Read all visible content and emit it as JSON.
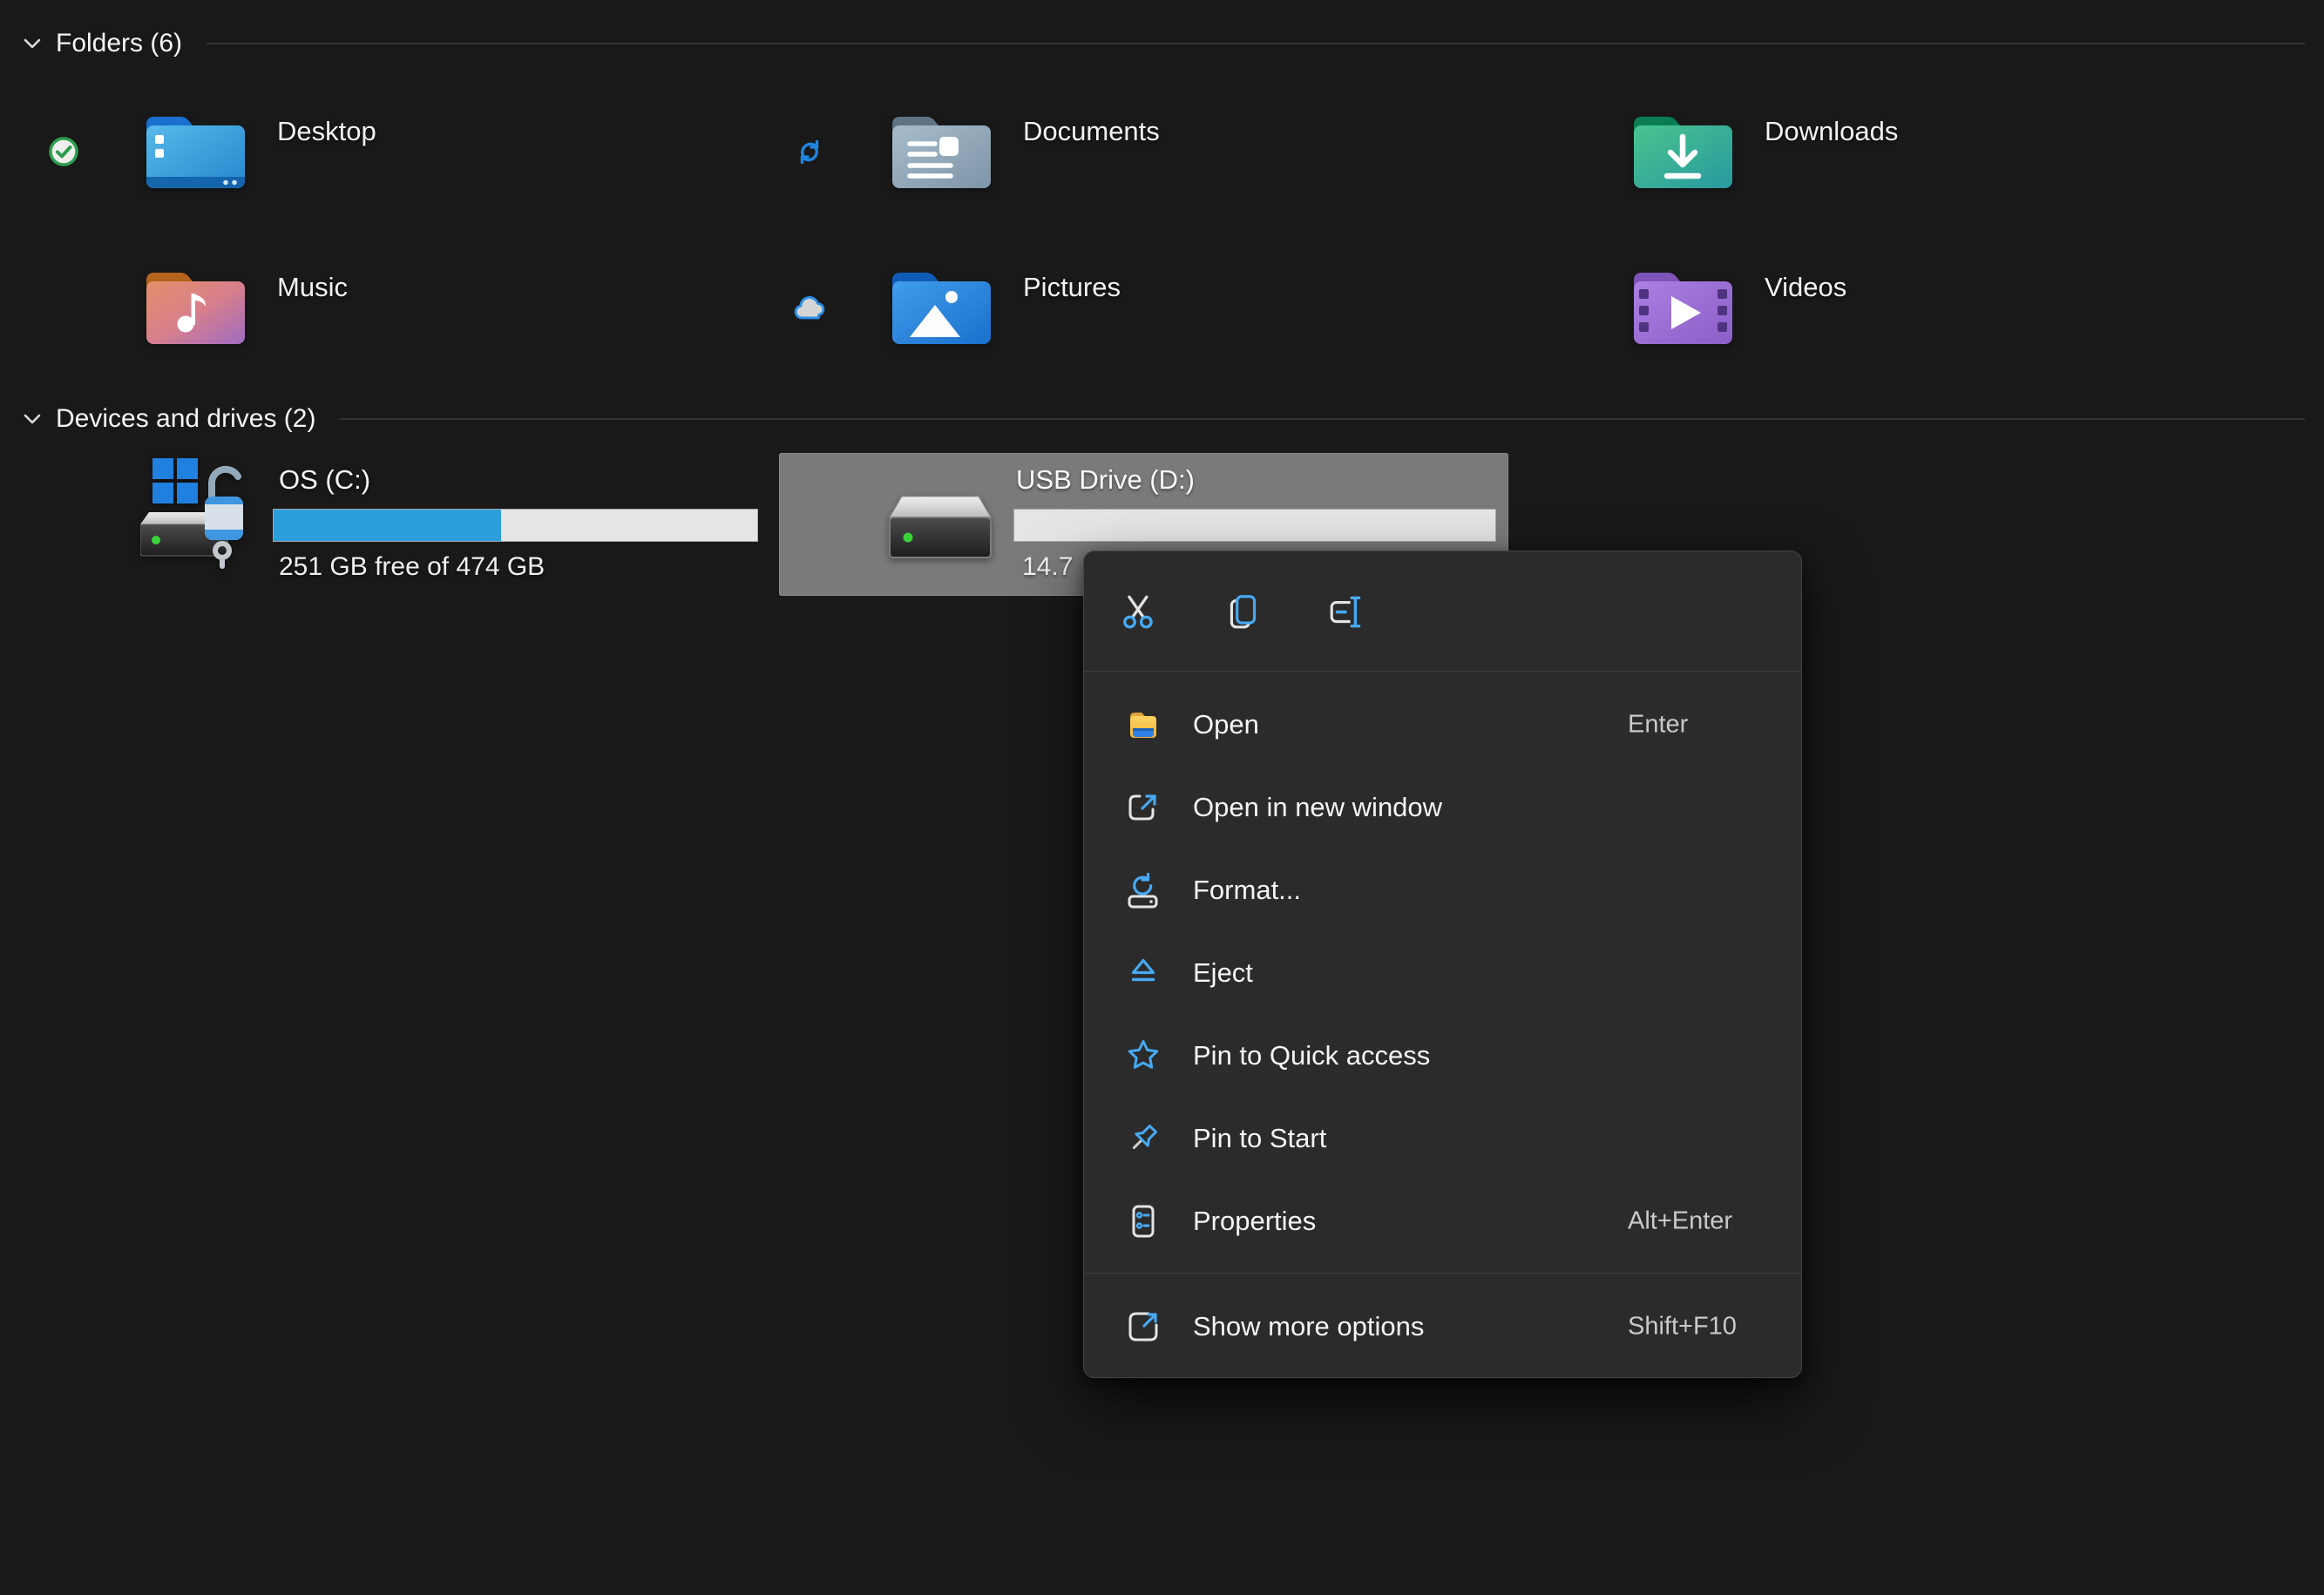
{
  "colors": {
    "background": "#191919",
    "selection_gray": "#7a7a7a",
    "menu_background": "#2b2b2b",
    "accent_blue": "#47a9f2",
    "capacity_bar_fill": "#2a9fd9",
    "capacity_bar_track": "#e5e5e5"
  },
  "sections": {
    "folders": {
      "label": "Folders (6)"
    },
    "devices": {
      "label": "Devices and drives (2)"
    }
  },
  "folders": [
    {
      "name": "Desktop",
      "sync_status": "synced"
    },
    {
      "name": "Documents",
      "sync_status": "syncing"
    },
    {
      "name": "Downloads",
      "sync_status": "none"
    },
    {
      "name": "Music",
      "sync_status": "none"
    },
    {
      "name": "Pictures",
      "sync_status": "online-only"
    },
    {
      "name": "Videos",
      "sync_status": "none"
    }
  ],
  "drives": [
    {
      "name": "OS (C:)",
      "capacity_text": "251 GB free of 474 GB",
      "used_percent": 47,
      "selected": false
    },
    {
      "name": "USB Drive (D:)",
      "capacity_text": "14.7",
      "used_percent": 0,
      "selected": true
    }
  ],
  "context_menu": {
    "quick_actions": [
      {
        "name": "Cut"
      },
      {
        "name": "Copy"
      },
      {
        "name": "Rename"
      }
    ],
    "items": [
      {
        "label": "Open",
        "shortcut": "Enter"
      },
      {
        "label": "Open in new window",
        "shortcut": ""
      },
      {
        "label": "Format...",
        "shortcut": ""
      },
      {
        "label": "Eject",
        "shortcut": ""
      },
      {
        "label": "Pin to Quick access",
        "shortcut": ""
      },
      {
        "label": "Pin to Start",
        "shortcut": ""
      },
      {
        "label": "Properties",
        "shortcut": "Alt+Enter"
      }
    ],
    "footer": {
      "label": "Show more options",
      "shortcut": "Shift+F10"
    }
  }
}
